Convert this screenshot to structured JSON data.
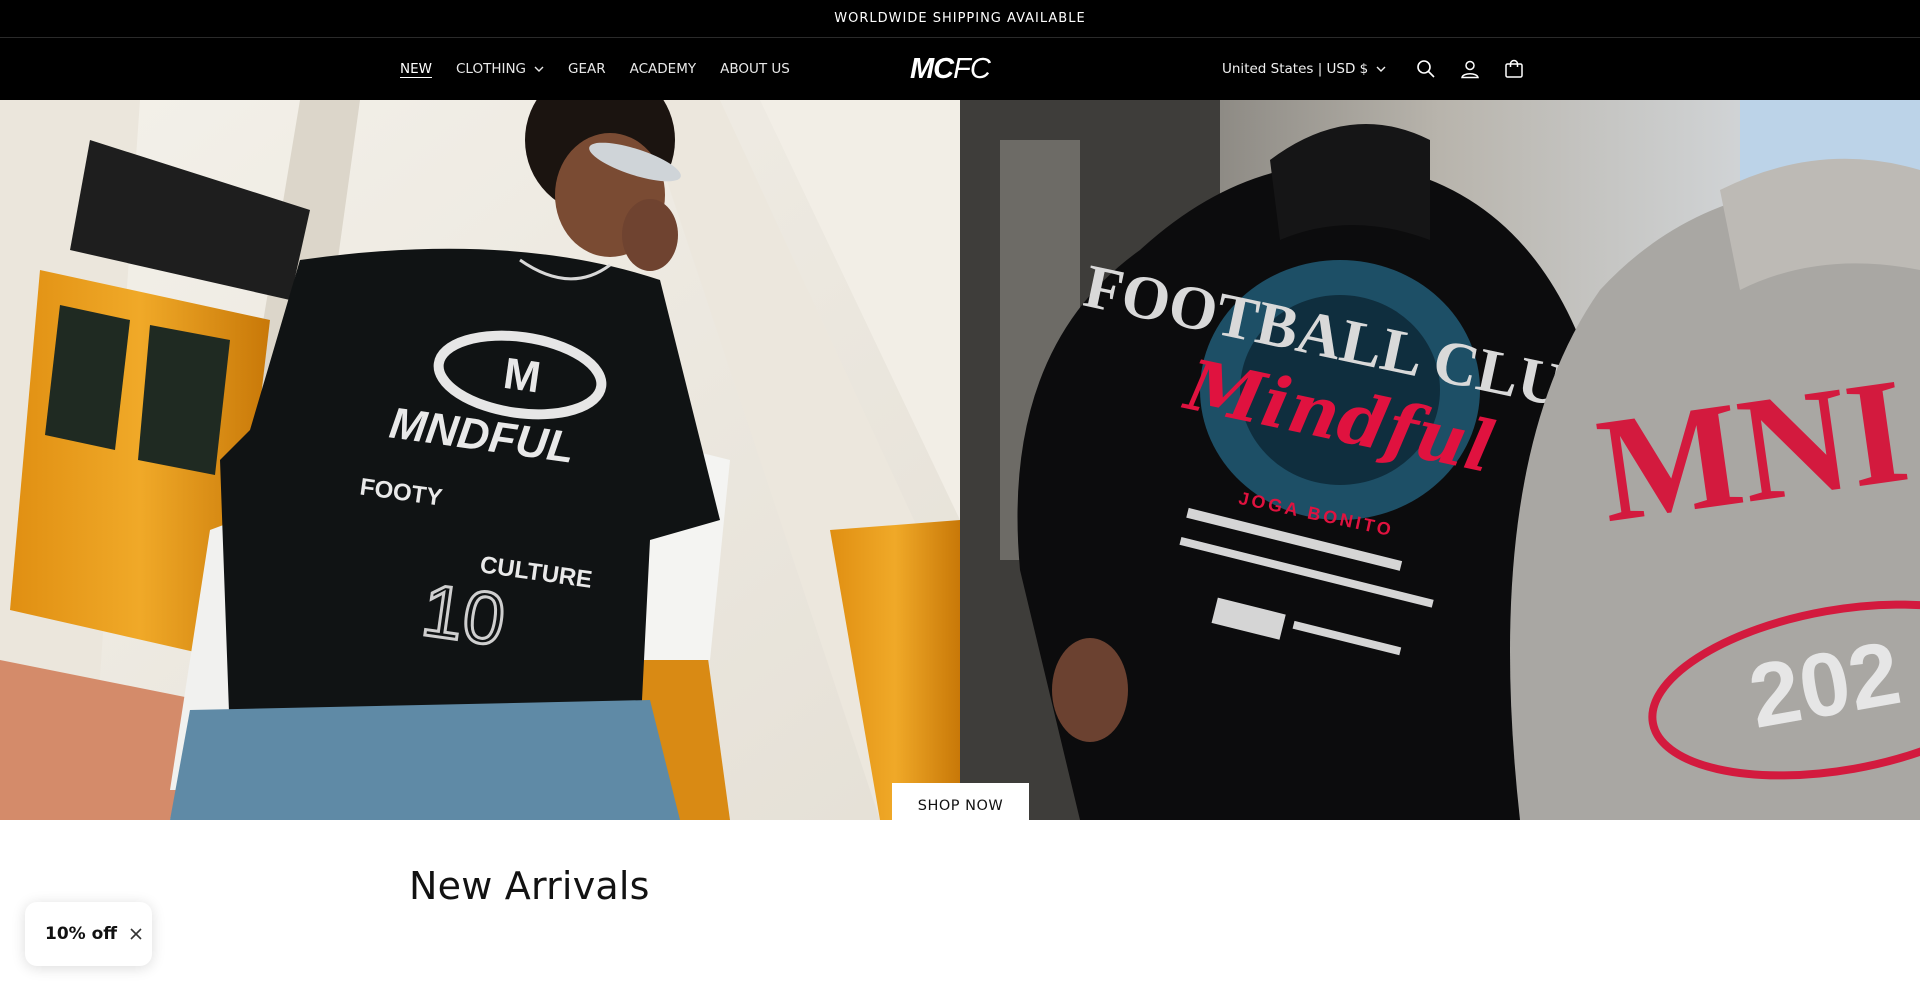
{
  "announcement": {
    "text": "WORLDWIDE SHIPPING AVAILABLE"
  },
  "header": {
    "nav": [
      {
        "label": "NEW",
        "active": true
      },
      {
        "label": "CLOTHING",
        "has_dropdown": true
      },
      {
        "label": "GEAR"
      },
      {
        "label": "ACADEMY"
      },
      {
        "label": "ABOUT US"
      }
    ],
    "logo": {
      "bold": "MC",
      "light": "FC"
    },
    "locale": "United States | USD $",
    "icons": [
      "search-icon",
      "account-icon",
      "cart-icon"
    ]
  },
  "hero": {
    "left_shirt": {
      "brand": "MNDFUL",
      "line1": "FOOTY",
      "line2": "CULTURE",
      "number": "10"
    },
    "right_hoodie": {
      "headline": "FOOTBALL CLUB",
      "script": "Mindful",
      "tagline": "JOGA BONITO"
    },
    "right_sweatshirt": {
      "text": "MNI",
      "year": "202"
    },
    "cta": "SHOP NOW"
  },
  "section": {
    "title": "New Arrivals"
  },
  "discount": {
    "label": "10% off"
  },
  "colors": {
    "bar": "#000000",
    "accent_red": "#e0123f",
    "page_bg": "#ffffff"
  }
}
